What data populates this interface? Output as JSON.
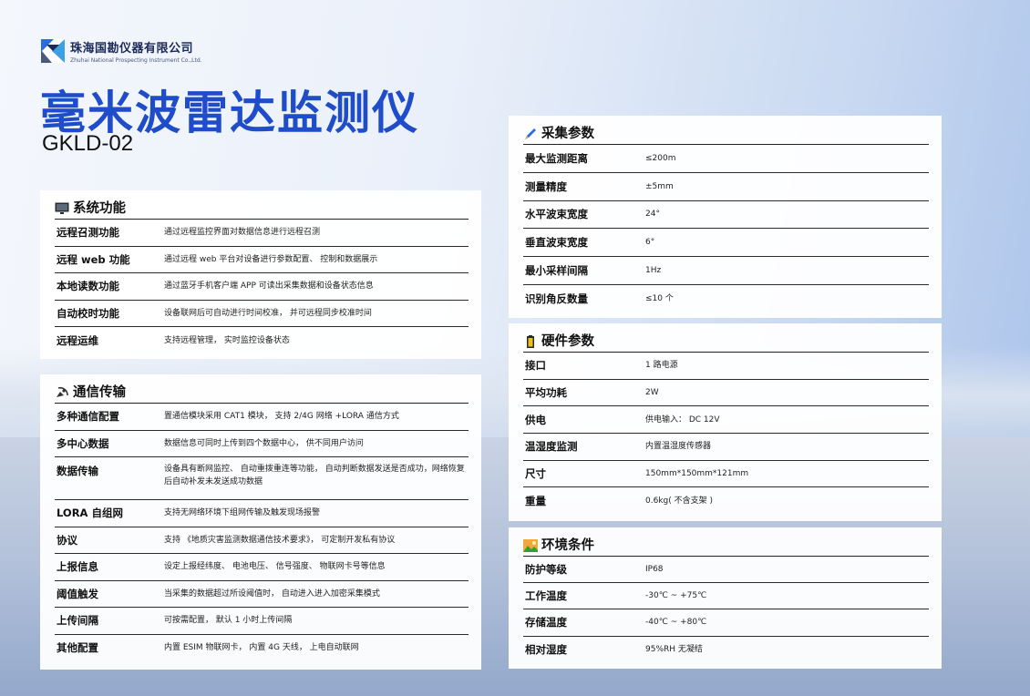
{
  "company": {
    "name_cn": "珠海国勘仪器有限公司",
    "name_en": "Zhuhai National Prospecting Instrument Co.,Ltd."
  },
  "product": {
    "title": "毫米波雷达监测仪",
    "model": "GKLD-02"
  },
  "sections": {
    "system": {
      "title": "系统功能",
      "rows": [
        {
          "k": "远程召测功能",
          "v": "通过远程监控界面对数据信息进行远程召测"
        },
        {
          "k": "远程 web 功能",
          "v": "通过远程 web 平台对设备进行参数配置、 控制和数据展示"
        },
        {
          "k": "本地读数功能",
          "v": "通过蓝牙手机客户端 APP 可读出采集数据和设备状态信息"
        },
        {
          "k": "自动校时功能",
          "v": "设备联网后可自动进行时间校准， 并可远程同步校准时间"
        },
        {
          "k": "远程运维",
          "v": "支持远程管理， 实时监控设备状态"
        }
      ]
    },
    "comm": {
      "title": "通信传输",
      "rows": [
        {
          "k": "多种通信配置",
          "v": "置通信模块采用 CAT1 模块， 支持 2/4G 网络 +LORA 通信方式"
        },
        {
          "k": "多中心数据",
          "v": "数据信息可同时上传到四个数据中心， 供不同用户访问"
        },
        {
          "k": "数据传输",
          "v": "设备具有断网监控、 自动重拨重连等功能， 自动判断数据发送是否成功，网络恢复后自动补发未发送成功数据"
        },
        {
          "k": "LORA 自组网",
          "v": "支持无网络环境下组网传输及触发现场报警"
        },
        {
          "k": "协议",
          "v": "支持 《地质灾害监测数据通信技术要求》， 可定制开发私有协议"
        },
        {
          "k": "上报信息",
          "v": "设定上报经纬度、 电池电压、 信号强度、 物联网卡号等信息"
        },
        {
          "k": "阈值触发",
          "v": "当采集的数据超过所设阈值时， 自动进入进入加密采集模式"
        },
        {
          "k": "上传间隔",
          "v": "可按需配置， 默认 1 小时上传间隔"
        },
        {
          "k": "其他配置",
          "v": "内置 ESIM 物联网卡， 内置 4G 天线， 上电自动联网"
        }
      ]
    },
    "collect": {
      "title": "采集参数",
      "rows": [
        {
          "k": "最大监测距离",
          "v": "≤200m"
        },
        {
          "k": "测量精度",
          "v": "±5mm"
        },
        {
          "k": "水平波束宽度",
          "v": "24°"
        },
        {
          "k": "垂直波束宽度",
          "v": "6°"
        },
        {
          "k": "最小采样间隔",
          "v": "1Hz"
        },
        {
          "k": "识别角反数量",
          "v": "≤10 个"
        }
      ]
    },
    "hardware": {
      "title": "硬件参数",
      "rows": [
        {
          "k": "接口",
          "v": "1 路电源"
        },
        {
          "k": "平均功耗",
          "v": "2W"
        },
        {
          "k": "供电",
          "v": "供电输入： DC 12V"
        },
        {
          "k": "温湿度监测",
          "v": "内置温湿度传感器"
        },
        {
          "k": "尺寸",
          "v": "150mm*150mm*121mm"
        },
        {
          "k": "重量",
          "v": "0.6kg( 不含支架 )"
        }
      ]
    },
    "env": {
      "title": "环境条件",
      "rows": [
        {
          "k": "防护等级",
          "v": "IP68"
        },
        {
          "k": "工作温度",
          "v": "-30℃ ~ +75℃"
        },
        {
          "k": "存储温度",
          "v": "-40℃ ~ +80℃"
        },
        {
          "k": "相对湿度",
          "v": "95%RH 无凝结"
        }
      ]
    }
  },
  "icons": {
    "system": "monitor-icon",
    "comm": "satellite-dish-icon",
    "collect": "pen-icon",
    "hardware": "battery-icon",
    "env": "landscape-icon"
  },
  "colors": {
    "title": "#1f4cc8",
    "accent": "#2b6de0"
  }
}
